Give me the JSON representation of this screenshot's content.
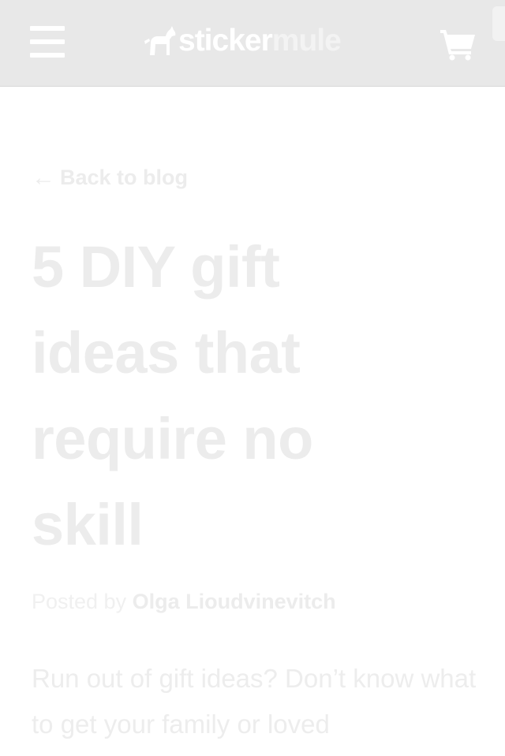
{
  "header": {
    "menu_icon": "hamburger-menu-icon",
    "logo": {
      "part1": "sticker",
      "part2": "mule",
      "icon": "mule-logo-icon"
    },
    "cart_icon": "shopping-cart-icon"
  },
  "post": {
    "back_link": "Back to blog",
    "back_arrow": "←",
    "title": "5 DIY gift ideas that require no skill",
    "byline_prefix": "Posted by",
    "author": "Olga Lioudvinevitch",
    "intro": "Run out of gift ideas? Don’t know what to get your family or loved"
  },
  "colors": {
    "header_bg": "#e8e8e8",
    "text_faded": "#ececec",
    "page_bg": "#ffffff"
  }
}
